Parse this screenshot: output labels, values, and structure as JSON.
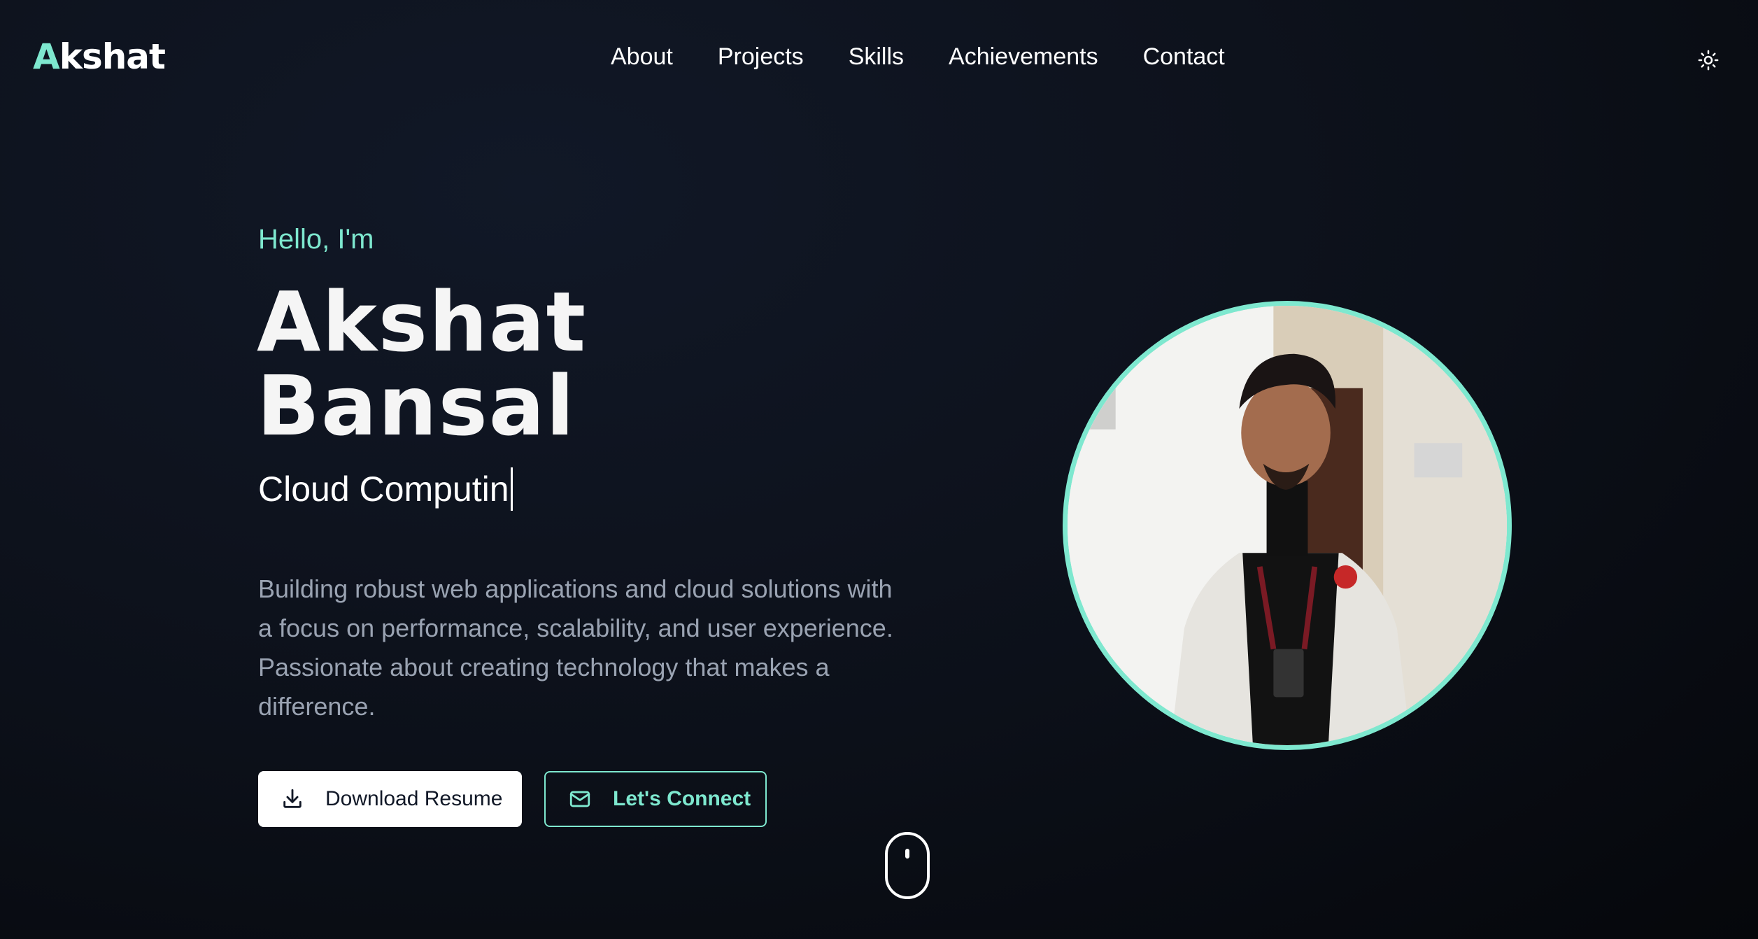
{
  "colors": {
    "accent": "#7ee8cf",
    "background": "#0c1019"
  },
  "nav": {
    "logo_first": "A",
    "logo_rest": "kshat",
    "links": [
      "About",
      "Projects",
      "Skills",
      "Achievements",
      "Contact"
    ],
    "theme_icon": "sun-icon"
  },
  "hero": {
    "greeting": "Hello, I'm",
    "name_line1": "Akshat",
    "name_line2": "Bansal",
    "typed_role": "Cloud Computin",
    "description": "Building robust web applications and cloud solutions with a focus on performance, scalability, and user experience. Passionate about creating technology that makes a difference.",
    "buttons": {
      "download_label": "Download Resume",
      "download_icon": "download-icon",
      "connect_label": "Let's Connect",
      "connect_icon": "mail-icon"
    }
  },
  "portrait": {
    "icon": "profile-photo"
  },
  "scroll": {
    "icon": "mouse-scroll-icon"
  }
}
